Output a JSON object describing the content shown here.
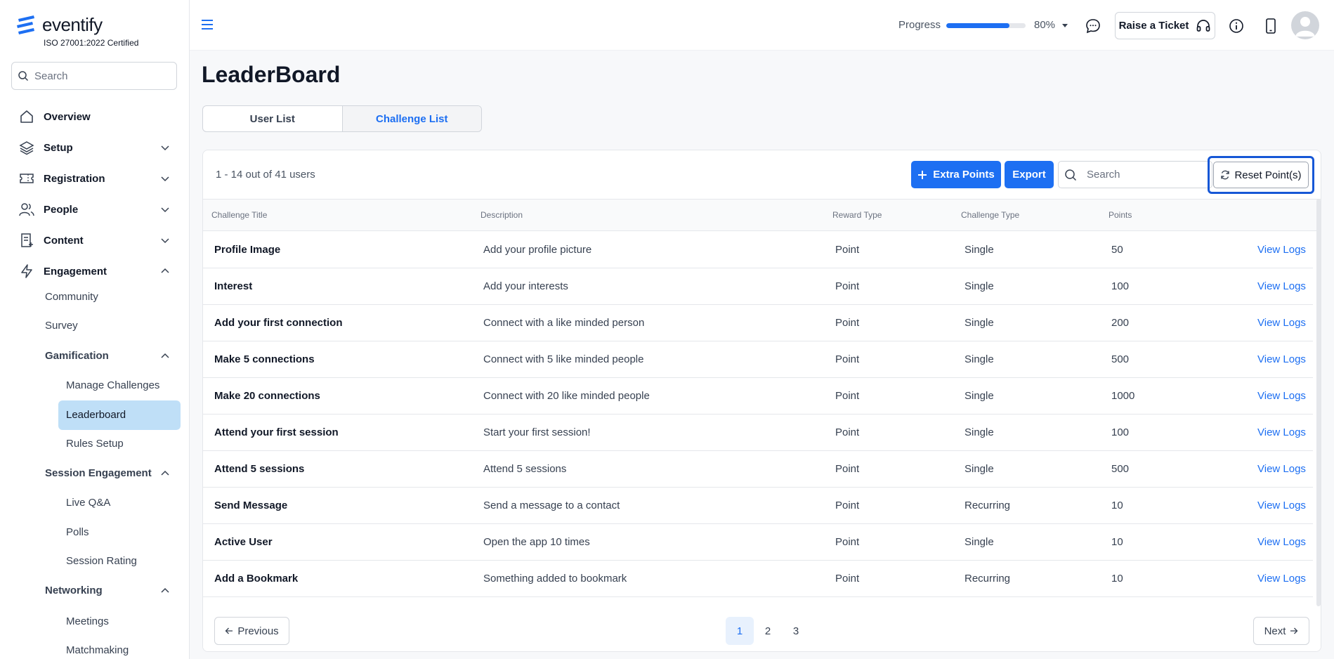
{
  "brand": {
    "name": "eventify",
    "subtitle": "ISO 27001:2022 Certified"
  },
  "sidebar": {
    "search_placeholder": "Search",
    "items": [
      {
        "label": "Overview",
        "icon": "home-icon"
      },
      {
        "label": "Setup",
        "icon": "layers-icon"
      },
      {
        "label": "Registration",
        "icon": "ticket-icon"
      },
      {
        "label": "People",
        "icon": "people-icon"
      },
      {
        "label": "Content",
        "icon": "document-icon"
      },
      {
        "label": "Engagement",
        "icon": "lightning-icon"
      }
    ],
    "engagement_sub": [
      "Community",
      "Survey"
    ],
    "gamification": {
      "label": "Gamification",
      "items": [
        "Manage Challenges",
        "Leaderboard",
        "Rules Setup"
      ]
    },
    "session_engagement": {
      "label": "Session Engagement",
      "items": [
        "Live Q&A",
        "Polls",
        "Session Rating"
      ]
    },
    "networking": {
      "label": "Networking",
      "items": [
        "Meetings",
        "Matchmaking"
      ]
    }
  },
  "topbar": {
    "progress_label": "Progress",
    "progress_value": "80%",
    "progress_fraction": 0.8,
    "ticket_label": "Raise a Ticket"
  },
  "page": {
    "title": "LeaderBoard"
  },
  "tabs": [
    "User List",
    "Challenge List"
  ],
  "table": {
    "count_text": "1 - 14 out of 41 users",
    "extra_points_label": "Extra Points",
    "export_label": "Export",
    "search_placeholder": "Search",
    "reset_label": "Reset Point(s)",
    "headers": [
      "Challenge Title",
      "Description",
      "Reward Type",
      "Challenge Type",
      "Points"
    ],
    "action_label": "View Logs",
    "rows": [
      [
        "Profile Image",
        "Add your profile picture",
        "Point",
        "Single",
        "50"
      ],
      [
        "Interest",
        "Add your interests",
        "Point",
        "Single",
        "100"
      ],
      [
        "Add your first connection",
        "Connect with a like minded person",
        "Point",
        "Single",
        "200"
      ],
      [
        "Make 5 connections",
        "Connect with 5 like minded people",
        "Point",
        "Single",
        "500"
      ],
      [
        "Make 20 connections",
        "Connect with 20 like minded people",
        "Point",
        "Single",
        "1000"
      ],
      [
        "Attend your first session",
        "Start your first session!",
        "Point",
        "Single",
        "100"
      ],
      [
        "Attend 5 sessions",
        "Attend 5 sessions",
        "Point",
        "Single",
        "500"
      ],
      [
        "Send Message",
        "Send a message to a contact",
        "Point",
        "Recurring",
        "10"
      ],
      [
        "Active User",
        "Open the app 10 times",
        "Point",
        "Single",
        "10"
      ],
      [
        "Add a Bookmark",
        "Something added to bookmark",
        "Point",
        "Recurring",
        "10"
      ]
    ]
  },
  "pagination": {
    "prev_label": "Previous",
    "next_label": "Next",
    "pages": [
      "1",
      "2",
      "3"
    ],
    "current": "1"
  },
  "colors": {
    "accent": "#1d6ff2",
    "active_nav": "#bfdff7",
    "focus_ring": "#1657d6"
  }
}
